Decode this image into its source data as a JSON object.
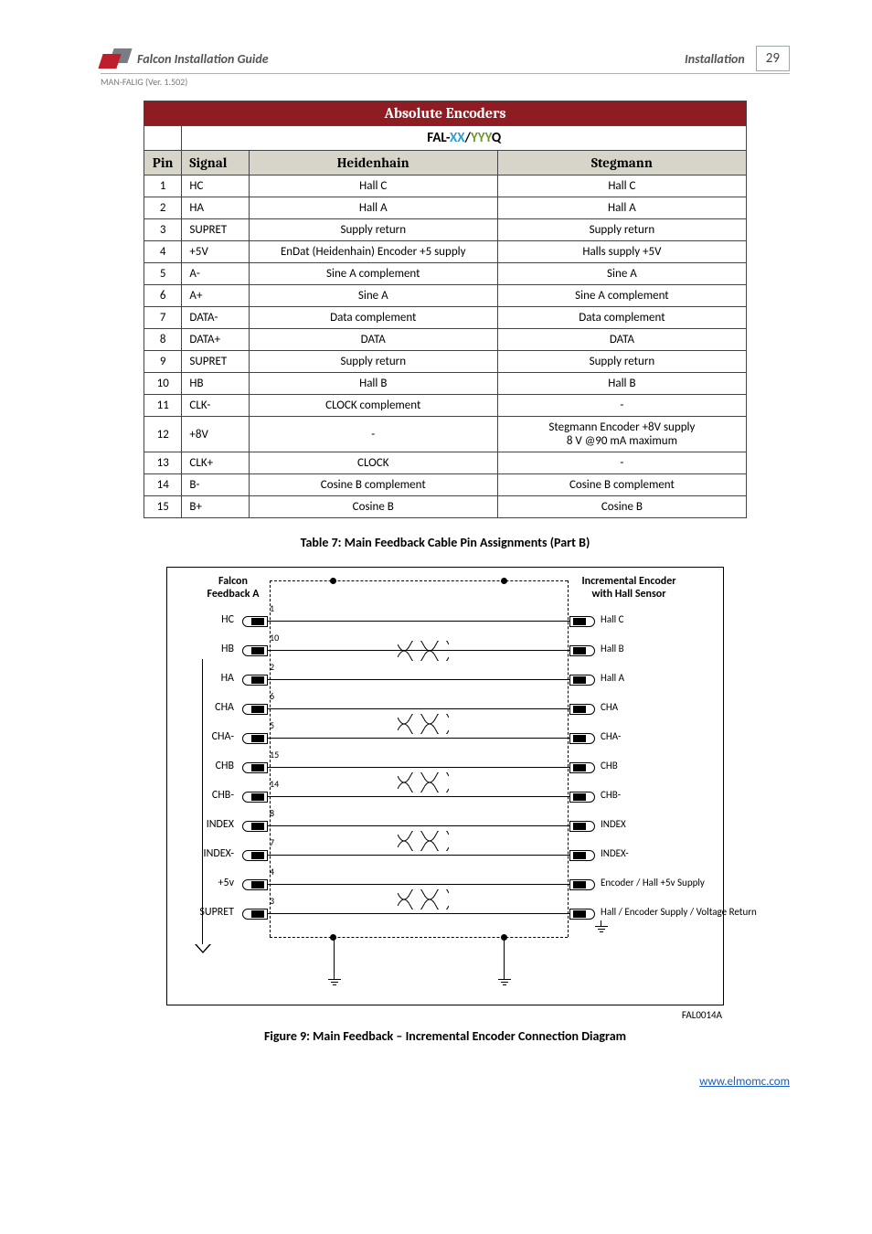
{
  "header": {
    "guide_title": "Falcon Installation Guide",
    "section": "Installation",
    "page_number": "29",
    "doc_ref": "MAN-FALIG (Ver. 1.502)"
  },
  "table": {
    "title": "Absolute Encoders",
    "model_prefix": "FAL-",
    "model_xx": "XX",
    "model_sep": "/",
    "model_yyy": "YYY",
    "model_suffix": "Q",
    "headers": {
      "pin": "Pin",
      "signal": "Signal",
      "col_a": "Heidenhain",
      "col_b": "Stegmann"
    },
    "rows": [
      {
        "pin": "1",
        "signal": "HC",
        "a": "Hall C",
        "b": "Hall C"
      },
      {
        "pin": "2",
        "signal": "HA",
        "a": "Hall A",
        "b": "Hall A"
      },
      {
        "pin": "3",
        "signal": "SUPRET",
        "a": "Supply return",
        "b": "Supply return"
      },
      {
        "pin": "4",
        "signal": "+5V",
        "a": "EnDat (Heidenhain) Encoder +5 supply",
        "b": "Halls supply +5V"
      },
      {
        "pin": "5",
        "signal": "A-",
        "a": "Sine A complement",
        "b": "Sine A"
      },
      {
        "pin": "6",
        "signal": "A+",
        "a": "Sine A",
        "b": "Sine A complement"
      },
      {
        "pin": "7",
        "signal": "DATA-",
        "a": "Data complement",
        "b": "Data complement"
      },
      {
        "pin": "8",
        "signal": "DATA+",
        "a": "DATA",
        "b": "DATA"
      },
      {
        "pin": "9",
        "signal": "SUPRET",
        "a": "Supply return",
        "b": "Supply return"
      },
      {
        "pin": "10",
        "signal": "HB",
        "a": "Hall B",
        "b": "Hall B"
      },
      {
        "pin": "11",
        "signal": "CLK-",
        "a": "CLOCK complement",
        "b": "-"
      },
      {
        "pin": "12",
        "signal": "+8V",
        "a": "-",
        "b": "Stegmann Encoder +8V supply\n8 V @90 mA maximum"
      },
      {
        "pin": "13",
        "signal": "CLK+",
        "a": "CLOCK",
        "b": "-"
      },
      {
        "pin": "14",
        "signal": "B-",
        "a": "Cosine B complement",
        "b": "Cosine B complement"
      },
      {
        "pin": "15",
        "signal": "B+",
        "a": "Cosine B",
        "b": "Cosine B"
      }
    ],
    "caption": "Table 7: Main Feedback Cable Pin Assignments (Part B)"
  },
  "diagram": {
    "left_block": "Falcon\nFeedback A",
    "right_block": "Incremental Encoder\nwith Hall Sensor",
    "lines": [
      {
        "pin": "1",
        "left": "HC",
        "right": "Hall C",
        "twist_group": 0
      },
      {
        "pin": "10",
        "left": "HB",
        "right": "Hall B",
        "twist_group": 0
      },
      {
        "pin": "2",
        "left": "HA",
        "right": "Hall A",
        "twist_group": 0
      },
      {
        "pin": "6",
        "left": "CHA",
        "right": "CHA",
        "twist_group": 1
      },
      {
        "pin": "5",
        "left": "CHA-",
        "right": "CHA-",
        "twist_group": 1
      },
      {
        "pin": "15",
        "left": "CHB",
        "right": "CHB",
        "twist_group": 2
      },
      {
        "pin": "14",
        "left": "CHB-",
        "right": "CHB-",
        "twist_group": 2
      },
      {
        "pin": "8",
        "left": "INDEX",
        "right": "INDEX",
        "twist_group": 3
      },
      {
        "pin": "7",
        "left": "INDEX-",
        "right": "INDEX-",
        "twist_group": 3
      },
      {
        "pin": "4",
        "left": "+5v",
        "right": "Encoder / Hall +5v Supply",
        "twist_group": 4
      },
      {
        "pin": "3",
        "left": "SUPRET",
        "right": "Hall / Encoder Supply / Voltage Return",
        "twist_group": 4
      }
    ],
    "id_label": "FAL0014A",
    "caption": "Figure 9: Main Feedback – Incremental Encoder Connection Diagram"
  },
  "footer": {
    "url": "www.elmomc.com"
  }
}
